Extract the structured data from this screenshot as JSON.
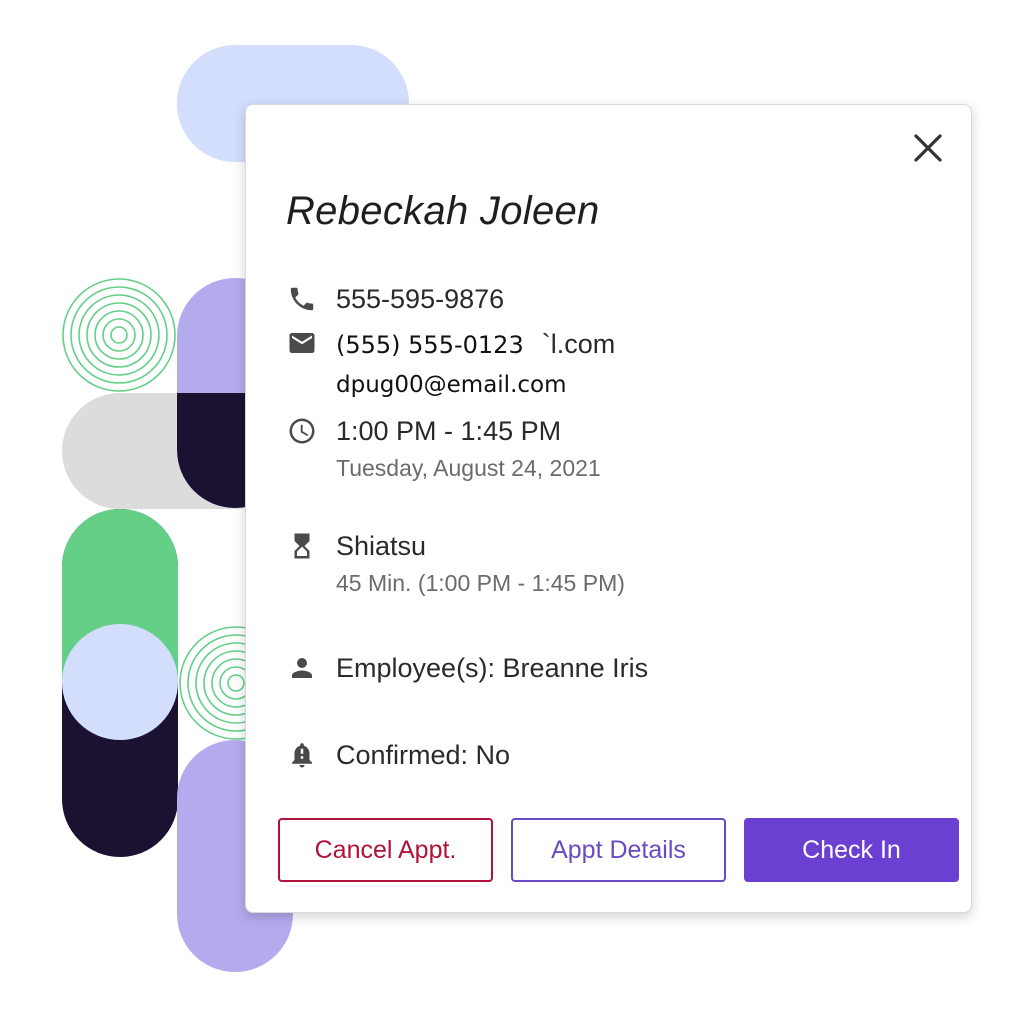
{
  "card": {
    "name": "Rebeckah Joleen",
    "phone": "555-595-9876",
    "email_line1_overlay": "(555) 555-0123",
    "email_line1_faint": "`l.com",
    "email_line2": "dpug00@email.com",
    "time": "1:00 PM - 1:45 PM",
    "date": "Tuesday, August 24, 2021",
    "service": "Shiatsu",
    "service_detail": "45 Min. (1:00 PM - 1:45 PM)",
    "employee": "Employee(s): Breanne Iris",
    "confirmed": "Confirmed: No"
  },
  "actions": {
    "cancel": "Cancel Appt.",
    "details": "Appt Details",
    "checkin": "Check In"
  },
  "icons": {
    "close": "close-icon",
    "phone": "phone-icon",
    "email": "email-icon",
    "time": "clock-icon",
    "service": "hourglass-icon",
    "employee": "person-icon",
    "confirmed": "bell-alert-icon"
  },
  "colors": {
    "accent": "#6a3fd1",
    "danger": "#b0123a",
    "deco_blue": "#d2defc",
    "deco_purple": "#b4abee",
    "deco_green": "#63cf87",
    "deco_dark": "#1b1232",
    "deco_grey": "#dcdcdc"
  }
}
